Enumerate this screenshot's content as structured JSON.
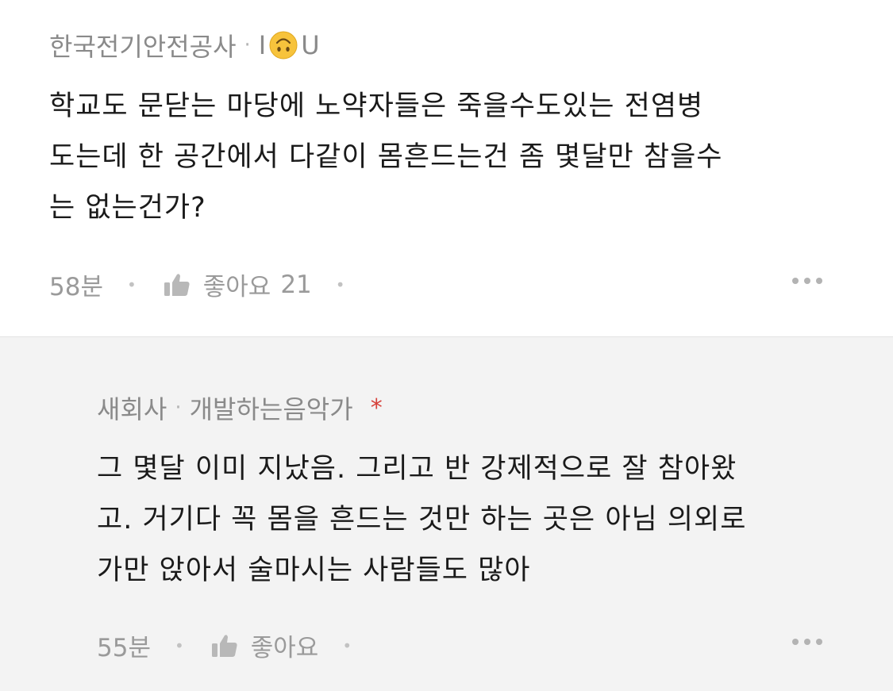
{
  "comments": [
    {
      "author": "한국전기안전공사",
      "nickname_prefix": "I",
      "nickname_emoji": "upside-down-face-emoji",
      "nickname_suffix": "U",
      "body_lines": [
        "학교도 문닫는 마당에 노약자들은 죽을수도있는 전염병",
        "도는데 한 공간에서 다같이 몸흔드는건 좀 몇달만 참을수",
        "는 없는건가?"
      ],
      "time": "58분",
      "like_label": "좋아요",
      "like_count": "21",
      "like_icon": "thumbs-up-icon",
      "more_icon": "more-dots-icon"
    },
    {
      "author": "새회사",
      "nickname": "개발하는음악가",
      "marker": "*",
      "body_lines": [
        "그 몇달 이미 지났음. 그리고 반 강제적으로 잘 참아왔",
        "고. 거기다 꼭 몸을 흔드는 것만 하는 곳은 아님 의외로",
        "가만 앉아서 술마시는 사람들도 많아"
      ],
      "time": "55분",
      "like_label": "좋아요",
      "like_icon": "thumbs-up-icon",
      "more_icon": "more-dots-icon"
    }
  ],
  "colors": {
    "reply_background": "#f3f3f3",
    "meta_text": "#8a8a8a",
    "body_text": "#1a1a1a",
    "marker": "#d6413a",
    "emoji_yellow": "#f7c33c"
  }
}
